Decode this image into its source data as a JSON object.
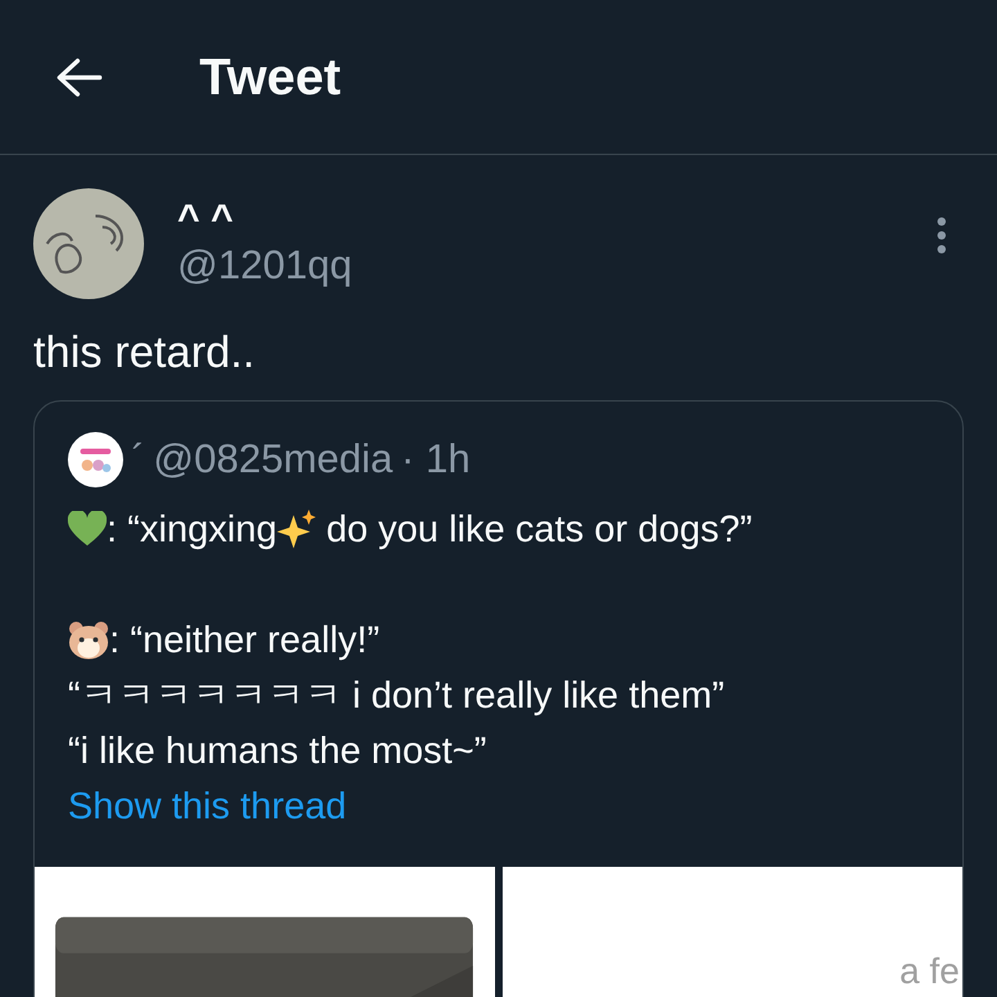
{
  "header": {
    "title": "Tweet"
  },
  "tweet": {
    "name": "^ ^",
    "handle": "@1201qq",
    "text": "this retard..",
    "quote": {
      "name": "´",
      "handle": "@0825media",
      "time": "· 1h",
      "lines": [
        {
          "kind": "content",
          "parts": [
            {
              "kind": "heart"
            },
            {
              "kind": "text",
              "text": ": “xingxing"
            },
            {
              "kind": "sparkles"
            },
            {
              "kind": "text",
              "text": " do you like cats or dogs?”"
            }
          ]
        },
        {
          "kind": "blank"
        },
        {
          "kind": "content",
          "parts": [
            {
              "kind": "hamster"
            },
            {
              "kind": "text",
              "text": ": “neither really!”"
            }
          ]
        },
        {
          "kind": "content",
          "parts": [
            {
              "kind": "text",
              "text": "“ㅋㅋㅋㅋㅋㅋㅋ i don’t really like them”"
            }
          ]
        },
        {
          "kind": "content",
          "parts": [
            {
              "kind": "text",
              "text": "“i like humans the most~”"
            }
          ]
        }
      ],
      "link": "Show this thread",
      "media": [
        {
          "kind": "picture"
        },
        {
          "kind": "text",
          "text": "a fe"
        }
      ]
    }
  }
}
